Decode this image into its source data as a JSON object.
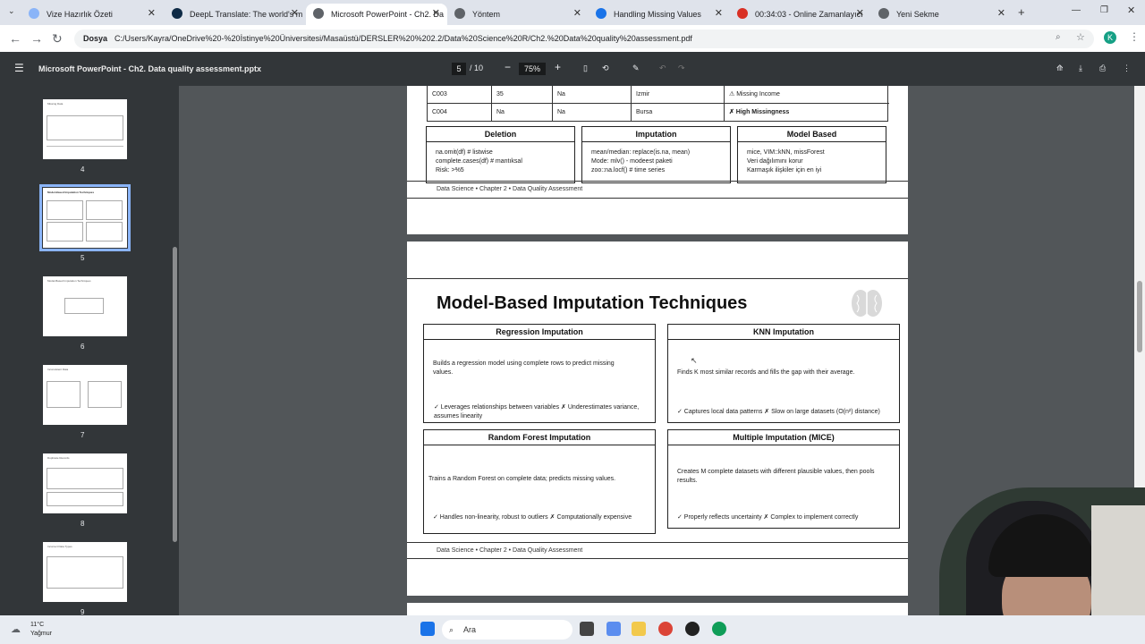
{
  "tabs": [
    {
      "label": "Vize Hazırlık Özeti",
      "color": "#8ab4f8"
    },
    {
      "label": "DeepL Translate: The world's m",
      "color": "#0f2b46"
    },
    {
      "label": "Microsoft PowerPoint - Ch2. Da",
      "color": "#5f6368"
    },
    {
      "label": "Yöntem",
      "color": "#5f6368"
    },
    {
      "label": "Handling Missing Values",
      "color": "#1a73e8"
    },
    {
      "label": "00:34:03 - Online Zamanlayıcı",
      "color": "#d93025"
    },
    {
      "label": "Yeni Sekme",
      "color": "#5f6368"
    }
  ],
  "address": {
    "prefix": "Dosya",
    "url": "C:/Users/Kayra/OneDrive%20-%20İstinye%20Üniversitesi/Masaüstü/DERSLER%20%202.2/Data%20Science%20R/Ch2.%20Data%20quality%20assessment.pdf",
    "avatar": "K"
  },
  "pdf": {
    "title": "Microsoft PowerPoint - Ch2. Data quality assessment.pptx",
    "page": "5",
    "total": "/ 10",
    "zoom": "75%",
    "minus": "−",
    "plus": "+"
  },
  "thumbs": [
    {
      "num": "4",
      "title": "Missing Data"
    },
    {
      "num": "5",
      "title": "Model-Based Imputation Techniques"
    },
    {
      "num": "6",
      "title": "Model-Based Imputation Techniques"
    },
    {
      "num": "7",
      "title": "Inconsistent Data"
    },
    {
      "num": "8",
      "title": "Duplicate Records"
    },
    {
      "num": "9",
      "title": "Incorrect Data Types"
    }
  ],
  "prev_page": {
    "rows": [
      [
        "C003",
        "35",
        "Na",
        "Izmir",
        "⚠ Missing Income"
      ],
      [
        "C004",
        "Na",
        "Na",
        "Bursa",
        "✗ High Missingness"
      ]
    ],
    "boxes": [
      {
        "title": "Deletion",
        "lines": [
          "na.omit(df)  # listwise",
          "complete.cases(df)  # mantıksal",
          "Risk: >%5"
        ]
      },
      {
        "title": "Imputation",
        "lines": [
          "mean/median: replace(is.na, mean)",
          "Mode: mlv() - modeest paketi",
          "zoo::na.locf()  # time series"
        ]
      },
      {
        "title": "Model Based",
        "lines": [
          "mice, VIM::kNN, missForest",
          "Veri dağılımını korur",
          "Karmaşık ilişkiler için en iyi"
        ]
      }
    ],
    "footer": "Data Science  •  Chapter 2  •  Data Quality Assessment"
  },
  "slide": {
    "title": "Model-Based Imputation Techniques",
    "boxes": [
      {
        "title": "Regression Imputation",
        "body": "Builds a regression model using complete rows to predict missing values.",
        "note": "✓ Leverages relationships between variables   ✗ Underestimates variance, assumes linearity"
      },
      {
        "title": "KNN Imputation",
        "body": "Finds K most similar records and fills the gap with their average.",
        "note": "✓ Captures local data patterns   ✗ Slow on large datasets (O(n²) distance)"
      },
      {
        "title": "Random Forest Imputation",
        "body": "Trains a Random Forest on complete data; predicts missing values.",
        "note": "✓ Handles non-linearity, robust to outliers   ✗ Computationally expensive"
      },
      {
        "title": "Multiple Imputation (MICE)",
        "body": "Creates M complete datasets with different plausible values, then pools results.",
        "note": "✓ Properly reflects uncertainty   ✗ Complex to implement correctly"
      }
    ],
    "footer": "Data Science  •  Chapter 2  •  Data Quality Assessment"
  },
  "taskbar": {
    "temp": "11°C",
    "weather": "Yağmur",
    "search": "Ara"
  }
}
